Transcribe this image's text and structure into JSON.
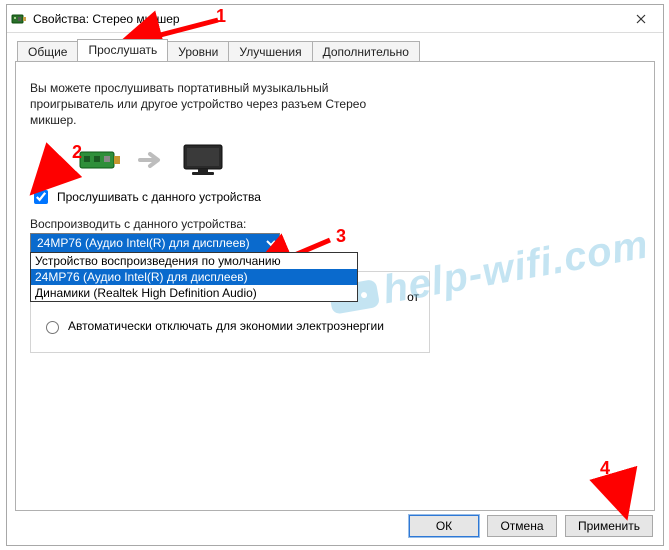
{
  "window": {
    "title": "Свойства: Стерео микшер"
  },
  "tabs": {
    "general": "Общие",
    "listen": "Прослушать",
    "levels": "Уровни",
    "enhance": "Улучшения",
    "advanced": "Дополнительно"
  },
  "listen_tab": {
    "description_line1": "Вы можете прослушивать портативный музыкальный",
    "description_line2": "проигрыватель или другое устройство через разъем Стерео",
    "description_line3": "микшер.",
    "checkbox_label": "Прослушивать с данного устройства",
    "checkbox_checked": true,
    "playback_label": "Воспроизводить с данного устройства:",
    "dropdown_selected": "24MP76 (Аудио Intel(R) для дисплеев)",
    "dropdown_options": [
      "Устройство воспроизведения по умолчанию",
      "24MP76 (Аудио Intel(R) для дисплеев)",
      "Динамики (Realtek High Definition Audio)"
    ],
    "radio_trailing_fragment": "от",
    "radio_auto_off": "Автоматически отключать для экономии электроэнергии"
  },
  "buttons": {
    "ok": "ОК",
    "cancel": "Отмена",
    "apply": "Применить"
  },
  "callouts": {
    "n1": "1",
    "n2": "2",
    "n3": "3",
    "n4": "4"
  },
  "watermark": {
    "text": "help-wifi.com"
  }
}
